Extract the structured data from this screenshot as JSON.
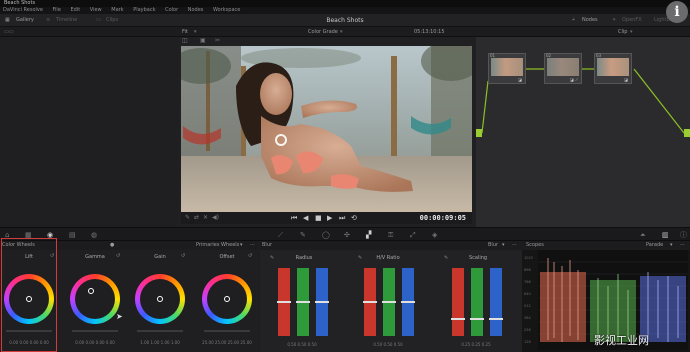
{
  "app": {
    "window_title": "Beach Shots"
  },
  "menu": [
    "DaVinci Resolve",
    "File",
    "Edit",
    "View",
    "Mark",
    "Playback",
    "Color",
    "Nodes",
    "Workspace"
  ],
  "topbar": {
    "gallery": "Gallery",
    "timeline": "Timeline",
    "clips": "Clips",
    "project_title": "Beach Shots",
    "nodes": "Nodes",
    "openfx": "OpenFX",
    "lightbox": "Lightbox",
    "info_icon": "i"
  },
  "row2": {
    "fit": "Fit",
    "color_grade": "Color Grade",
    "timecode_top": "05:13:10:15",
    "clip": "Clip"
  },
  "transport": {
    "timecode": "00:00:09:05"
  },
  "nodes": [
    {
      "num": "01"
    },
    {
      "num": "02"
    },
    {
      "num": "03"
    }
  ],
  "color_wheels": {
    "header": "Color Wheels",
    "mode": "Primaries Wheels",
    "wheels": [
      {
        "label": "Lift",
        "values": [
          "0.00",
          "0.00",
          "0.00",
          "0.00"
        ]
      },
      {
        "label": "Gamma",
        "values": [
          "0.00",
          "0.00",
          "0.00",
          "0.00"
        ]
      },
      {
        "label": "Gain",
        "values": [
          "1.00",
          "1.00",
          "1.00",
          "1.00"
        ]
      },
      {
        "label": "Offset",
        "values": [
          "25.00",
          "25.00",
          "25.00",
          "25.00"
        ]
      }
    ]
  },
  "blur": {
    "header": "Blur",
    "mode": "Blur",
    "groups": [
      {
        "label": "Radius",
        "values": [
          "0.50",
          "0.50",
          "0.50"
        ]
      },
      {
        "label": "H/V Ratio",
        "values": [
          "0.50",
          "0.50",
          "0.50"
        ]
      },
      {
        "label": "Scaling",
        "values": [
          "0.25",
          "0.25",
          "0.25"
        ]
      }
    ]
  },
  "scopes": {
    "header": "Scopes",
    "mode": "Parade",
    "scale": [
      "1023",
      "896",
      "768",
      "640",
      "512",
      "384",
      "256",
      "128"
    ]
  },
  "watermark": "影视工业网",
  "colors": {
    "accent_green": "#8cbf26",
    "highlight_red": "#d43b3b",
    "bar_red": "#c8362c",
    "bar_green": "#2e9a3a",
    "bar_blue": "#2d62c8"
  }
}
